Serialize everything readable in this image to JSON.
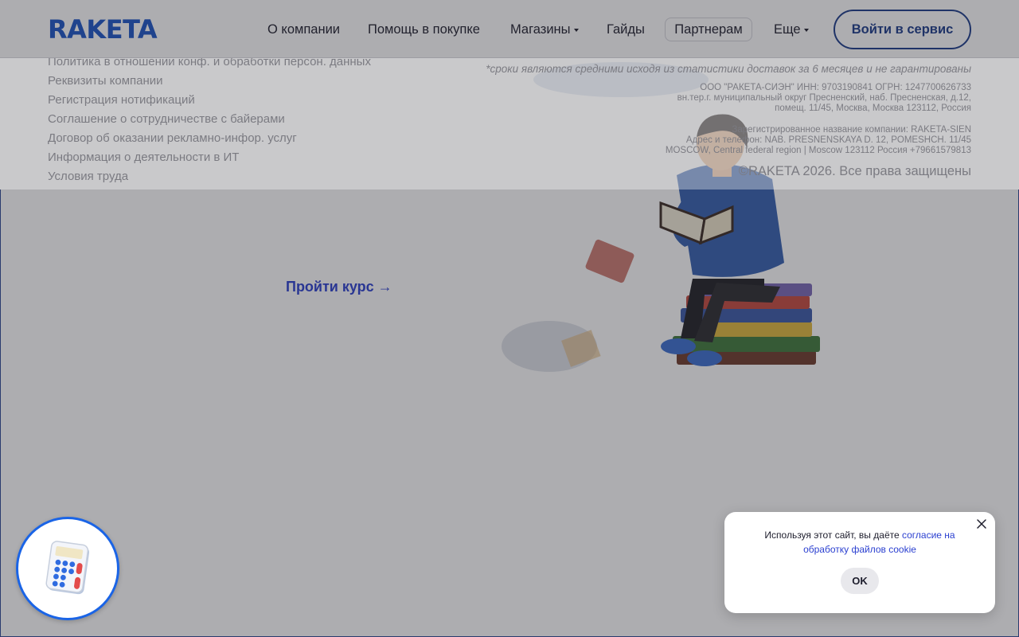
{
  "header": {
    "logo": "RAKETA",
    "nav": [
      {
        "label": "О компании",
        "has_dropdown": false
      },
      {
        "label": "Помощь в покупке",
        "has_dropdown": false
      },
      {
        "label": "Магазины",
        "has_dropdown": true
      },
      {
        "label": "Гайды",
        "has_dropdown": false
      },
      {
        "label": "Партнерам",
        "has_dropdown": false
      },
      {
        "label": "Еще",
        "has_dropdown": true
      }
    ],
    "login_label": "Войти в сервис"
  },
  "footer": {
    "links": [
      "Политика в отношении конф. и обработки персон. данных",
      "Реквизиты компании",
      "Регистрация нотификаций",
      "Соглашение о сотрудничестве с байерами",
      "Договор об оказании рекламно-инфор. услуг",
      "Информация о деятельности в ИТ",
      "Условия труда"
    ],
    "delivery_note": "*сроки являются средними исходя из статистики доставок за 6 месяцев и не гарантированы",
    "company_line1": "ООО \"РАКЕТА-СИЭН\" ИНН: 9703190841 ОГРН: 1247700626733",
    "company_line2": "вн.тер.г. муниципальный округ Пресненский, наб. Пресненская, д.12,",
    "company_line3": "помещ. 11/45, Москва, Москва 123112, Россия",
    "intl_line1": "Зарегистрированное название компании: RAKETA-SIEN",
    "intl_line2": "Адрес и телефон: NAB. PRESNENSKAYA D. 12, POMESHCH. 11/45",
    "intl_line3": "MOSCOW, Central federal region | Moscow 123112 Россия +79661579813",
    "copyright": "©RAKETA 2026. Все права защищены"
  },
  "course": {
    "link_label": "Пройти курс →"
  },
  "cookie": {
    "text": "Используя этот сайт, вы даёте ",
    "link": "согласие на обработку файлов cookie",
    "ok_label": "OK"
  },
  "icons": {
    "calculator": "calculator-icon",
    "close": "close-icon",
    "caret": "caret-down-icon"
  },
  "colors": {
    "brand": "#1a55c7",
    "accent_link": "#2a3fd0",
    "login_border": "#1a3a8a",
    "calc_ring": "#1a64e6"
  }
}
